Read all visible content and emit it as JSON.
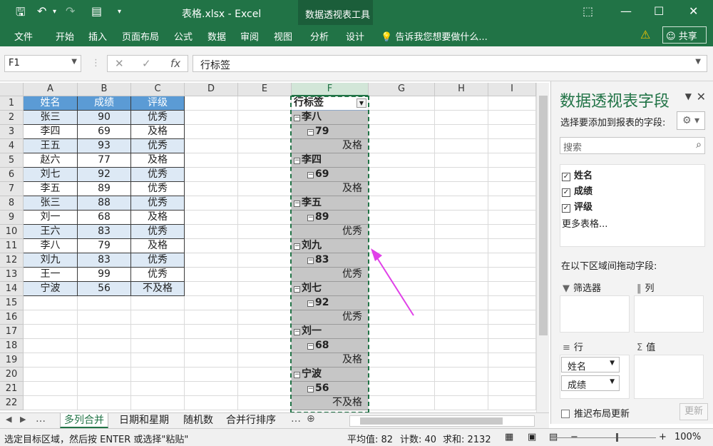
{
  "titlebar": {
    "save_icon": "save-icon",
    "undo_icon": "undo-icon",
    "redo_icon": "redo-icon",
    "title": "表格.xlsx - Excel",
    "ctx_tools": "数据透视表工具"
  },
  "ribbon": {
    "tabs": [
      "文件",
      "开始",
      "插入",
      "页面布局",
      "公式",
      "数据",
      "审阅",
      "视图",
      "分析",
      "设计"
    ],
    "tell_me": "告诉我您想要做什么...",
    "share": "共享"
  },
  "formula": {
    "namebox": "F1",
    "value": "行标签"
  },
  "columns": [
    "A",
    "B",
    "C",
    "D",
    "E",
    "F",
    "G",
    "H",
    "I"
  ],
  "rows": [
    "1",
    "2",
    "3",
    "4",
    "5",
    "6",
    "7",
    "8",
    "9",
    "10",
    "11",
    "12",
    "13",
    "14",
    "15",
    "16",
    "17",
    "18",
    "19",
    "20",
    "21",
    "22"
  ],
  "table": {
    "headers": [
      "姓名",
      "成绩",
      "评级"
    ],
    "rows": [
      [
        "张三",
        "90",
        "优秀"
      ],
      [
        "李四",
        "69",
        "及格"
      ],
      [
        "王五",
        "93",
        "优秀"
      ],
      [
        "赵六",
        "77",
        "及格"
      ],
      [
        "刘七",
        "92",
        "优秀"
      ],
      [
        "李五",
        "89",
        "优秀"
      ],
      [
        "张三",
        "88",
        "优秀"
      ],
      [
        "刘一",
        "68",
        "及格"
      ],
      [
        "王六",
        "83",
        "优秀"
      ],
      [
        "李八",
        "79",
        "及格"
      ],
      [
        "刘九",
        "83",
        "优秀"
      ],
      [
        "王一",
        "99",
        "优秀"
      ],
      [
        "宁波",
        "56",
        "不及格"
      ]
    ]
  },
  "pivot": {
    "header": "行标签",
    "rows": [
      {
        "level": 0,
        "text": "李八"
      },
      {
        "level": 1,
        "text": "79"
      },
      {
        "level": 2,
        "text": "及格"
      },
      {
        "level": 0,
        "text": "李四"
      },
      {
        "level": 1,
        "text": "69"
      },
      {
        "level": 2,
        "text": "及格"
      },
      {
        "level": 0,
        "text": "李五"
      },
      {
        "level": 1,
        "text": "89"
      },
      {
        "level": 2,
        "text": "优秀"
      },
      {
        "level": 0,
        "text": "刘九"
      },
      {
        "level": 1,
        "text": "83"
      },
      {
        "level": 2,
        "text": "优秀"
      },
      {
        "level": 0,
        "text": "刘七"
      },
      {
        "level": 1,
        "text": "92"
      },
      {
        "level": 2,
        "text": "优秀"
      },
      {
        "level": 0,
        "text": "刘一"
      },
      {
        "level": 1,
        "text": "68"
      },
      {
        "level": 2,
        "text": "及格"
      },
      {
        "level": 0,
        "text": "宁波"
      },
      {
        "level": 1,
        "text": "56"
      },
      {
        "level": 2,
        "text": "不及格"
      }
    ]
  },
  "pane": {
    "title": "数据透视表字段",
    "subtitle": "选择要添加到报表的字段:",
    "search_placeholder": "搜索",
    "fields": [
      "姓名",
      "成绩",
      "评级"
    ],
    "more_tables": "更多表格...",
    "drag_text": "在以下区域间拖动字段:",
    "areas": {
      "filter": "筛选器",
      "columns": "列",
      "rows": "行",
      "values": "值"
    },
    "row_chips": [
      "姓名",
      "成绩"
    ],
    "defer": "推迟布局更新",
    "update": "更新"
  },
  "sheets": [
    "多列合并",
    "日期和星期",
    "随机数",
    "合并行排序"
  ],
  "status": {
    "message": "选定目标区域，然后按 ENTER 或选择\"粘贴\"",
    "average": "平均值: 82",
    "count": "计数: 40",
    "sum": "求和: 2132",
    "zoom": "100%"
  },
  "accent": "#217346"
}
